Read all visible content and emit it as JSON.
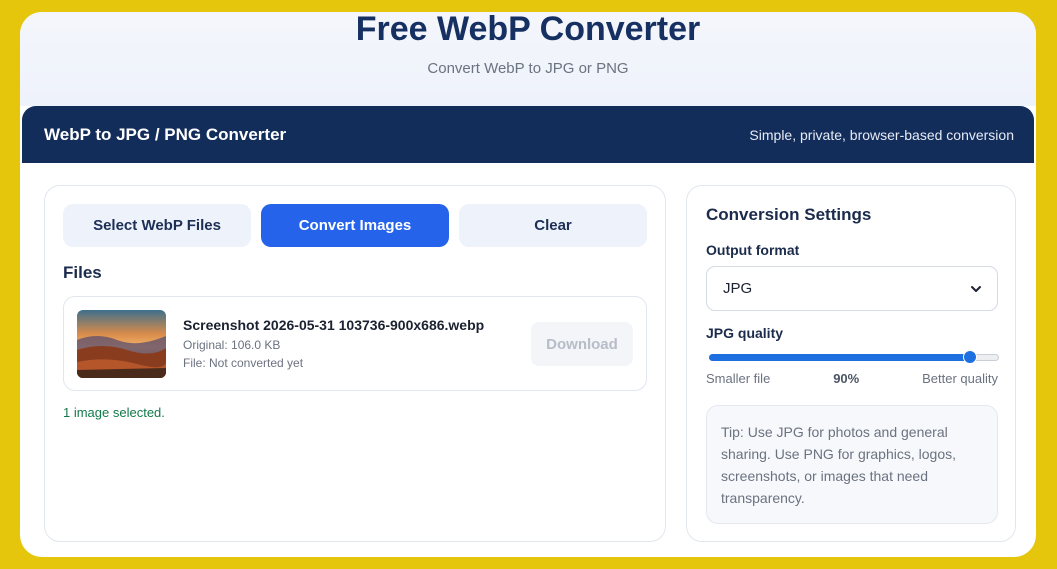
{
  "hero": {
    "title": "Free WebP Converter",
    "subtitle": "Convert WebP to JPG or PNG"
  },
  "header": {
    "title": "WebP to JPG / PNG Converter",
    "tagline": "Simple, private, browser-based conversion"
  },
  "actions": {
    "select_label": "Select WebP Files",
    "convert_label": "Convert Images",
    "clear_label": "Clear"
  },
  "files": {
    "heading": "Files",
    "items": [
      {
        "name": "Screenshot 2026-05-31 103736-900x686.webp",
        "original": "Original: 106.0 KB",
        "status": "File: Not converted yet",
        "download_label": "Download"
      }
    ],
    "selected_message": "1 image selected."
  },
  "settings": {
    "title": "Conversion Settings",
    "format_label": "Output format",
    "format_value": "JPG",
    "quality_label": "JPG quality",
    "quality_fraction": 0.9,
    "quality_display": "90%",
    "min_label": "Smaller file",
    "max_label": "Better quality",
    "tip": "Tip: Use JPG for photos and general sharing. Use PNG for graphics, logos, screenshots, or images that need transparency."
  },
  "colors": {
    "primary": "#2563eb",
    "header_bg": "#132d5b",
    "page_bg": "#e5c60c",
    "success": "#137a4a"
  }
}
